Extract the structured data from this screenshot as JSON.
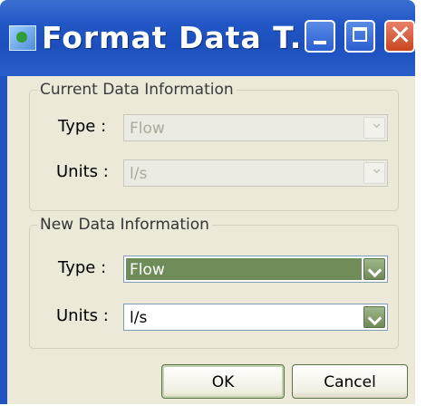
{
  "window": {
    "title": "Format Data T...",
    "controls": {
      "minimize": "minimize-icon",
      "maximize": "maximize-icon",
      "close": "close-icon"
    }
  },
  "current": {
    "legend": "Current Data Information",
    "type_label": "Type :",
    "type_value": "Flow",
    "units_label": "Units :",
    "units_value": "l/s"
  },
  "new": {
    "legend": "New Data Information",
    "type_label": "Type :",
    "type_value": "Flow",
    "units_label": "Units :",
    "units_value": "l/s"
  },
  "buttons": {
    "ok": "OK",
    "cancel": "Cancel"
  },
  "colors": {
    "titlebar": "#2357c6",
    "face": "#ece9d8",
    "accent": "#6f8c59"
  }
}
